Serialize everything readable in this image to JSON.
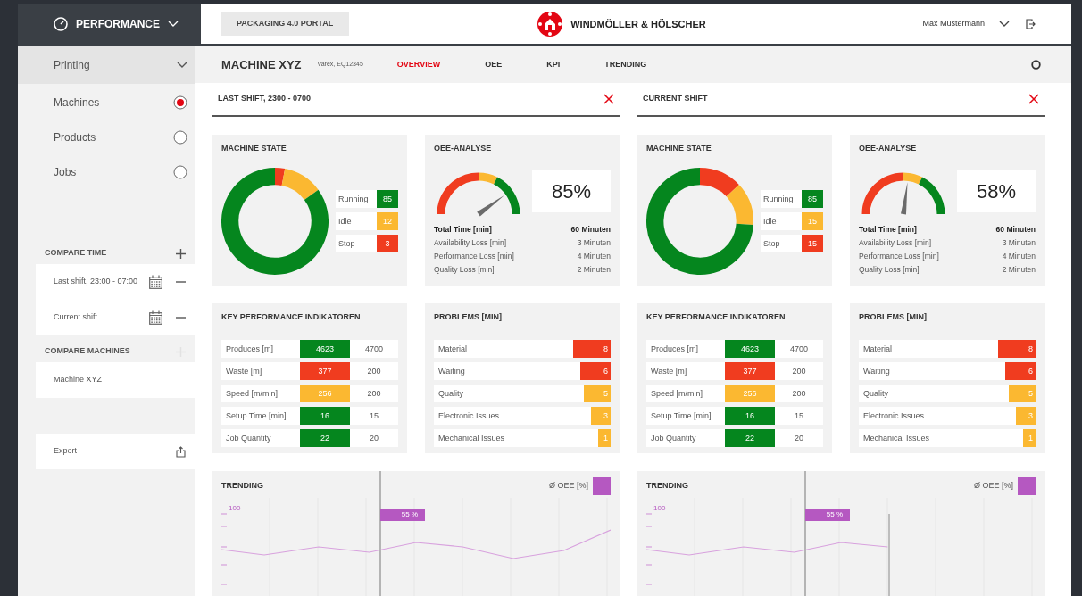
{
  "header": {
    "module": "PERFORMANCE",
    "portal": "PACKAGING 4.0 PORTAL",
    "brand": "WINDMÖLLER & HÖLSCHER",
    "user": "Max Mustermann"
  },
  "sidebar": {
    "category": "Printing",
    "items": [
      {
        "label": "Machines",
        "selected": true
      },
      {
        "label": "Products",
        "selected": false
      },
      {
        "label": "Jobs",
        "selected": false
      }
    ],
    "compare_time": {
      "title": "COMPARE TIME",
      "entries": [
        "Last shift, 23:00 - 07:00",
        "Current shift"
      ]
    },
    "compare_machines": {
      "title": "COMPARE MACHINES",
      "add_disabled": true,
      "entries": [
        "Machine XYZ"
      ]
    },
    "export": "Export"
  },
  "machine": {
    "name": "MACHINE XYZ",
    "subtitle": "Varex, EQ12345",
    "tabs": [
      {
        "label": "OVERVIEW",
        "selected": true
      },
      {
        "label": "OEE",
        "selected": false
      },
      {
        "label": "KPI",
        "selected": false
      },
      {
        "label": "TRENDING",
        "selected": false
      }
    ]
  },
  "shifts": [
    {
      "title": "LAST SHIFT, 2300 - 0700",
      "machine_state": {
        "title": "MACHINE STATE",
        "segments": [
          {
            "label": "Running",
            "value": "85",
            "color": "#05861e"
          },
          {
            "label": "Idle",
            "value": "12",
            "color": "#fbb831"
          },
          {
            "label": "Stop",
            "value": "3",
            "color": "#f03c1f"
          }
        ]
      },
      "oee": {
        "title": "OEE-ANALYSE",
        "percent": "85%",
        "rows": [
          {
            "label": "Total Time [min]",
            "value": "60 Minuten",
            "kind": "total"
          },
          {
            "label": "Availability Loss [min]",
            "value": "3 Minuten",
            "kind": "loss"
          },
          {
            "label": "Performance Loss [min]",
            "value": "4 Minuten",
            "kind": "loss"
          },
          {
            "label": "Quality Loss [min]",
            "value": "2 Minuten",
            "kind": "loss"
          }
        ]
      },
      "kpi": {
        "title": "KEY PERFORMANCE INDIKATOREN",
        "rows": [
          {
            "label": "Produces [m]",
            "actual": "4623",
            "target": "4700",
            "color": "#05861e"
          },
          {
            "label": "Waste [m]",
            "actual": "377",
            "target": "200",
            "color": "#f03c1f"
          },
          {
            "label": "Speed [m/min]",
            "actual": "256",
            "target": "200",
            "color": "#fbb831"
          },
          {
            "label": "Setup Time [min]",
            "actual": "16",
            "target": "15",
            "color": "#05861e"
          },
          {
            "label": "Job Quantity",
            "actual": "22",
            "target": "20",
            "color": "#05861e"
          }
        ]
      },
      "problems": {
        "title": "PROBLEMS [MIN]",
        "rows": [
          {
            "label": "Material",
            "value": "8",
            "color": "#f03c1f"
          },
          {
            "label": "Waiting",
            "value": "6",
            "color": "#f03c1f"
          },
          {
            "label": "Quality",
            "value": "5",
            "color": "#fbb831"
          },
          {
            "label": "Electronic Issues",
            "value": "3",
            "color": "#fbb831"
          },
          {
            "label": "Mechanical Issues",
            "value": "1",
            "color": "#fbb831"
          }
        ]
      },
      "trending": {
        "title": "TRENDING",
        "legend": "Ø OEE [%]",
        "tooltip": "55 %",
        "axis_label": "100"
      }
    },
    {
      "title": "CURRENT SHIFT",
      "machine_state": {
        "title": "MACHINE STATE",
        "segments": [
          {
            "label": "Running",
            "value": "85",
            "color": "#05861e"
          },
          {
            "label": "Idle",
            "value": "15",
            "color": "#fbb831"
          },
          {
            "label": "Stop",
            "value": "15",
            "color": "#f03c1f"
          }
        ]
      },
      "oee": {
        "title": "OEE-ANALYSE",
        "percent": "58%",
        "rows": [
          {
            "label": "Total Time [min]",
            "value": "60 Minuten",
            "kind": "total"
          },
          {
            "label": "Availability Loss [min]",
            "value": "3 Minuten",
            "kind": "loss"
          },
          {
            "label": "Performance Loss [min]",
            "value": "4 Minuten",
            "kind": "loss"
          },
          {
            "label": "Quality Loss [min]",
            "value": "2 Minuten",
            "kind": "loss"
          }
        ]
      },
      "kpi": {
        "title": "KEY PERFORMANCE INDIKATOREN",
        "rows": [
          {
            "label": "Produces [m]",
            "actual": "4623",
            "target": "4700",
            "color": "#05861e"
          },
          {
            "label": "Waste [m]",
            "actual": "377",
            "target": "200",
            "color": "#f03c1f"
          },
          {
            "label": "Speed [m/min]",
            "actual": "256",
            "target": "200",
            "color": "#fbb831"
          },
          {
            "label": "Setup Time [min]",
            "actual": "16",
            "target": "15",
            "color": "#05861e"
          },
          {
            "label": "Job Quantity",
            "actual": "22",
            "target": "20",
            "color": "#05861e"
          }
        ]
      },
      "problems": {
        "title": "PROBLEMS [MIN]",
        "rows": [
          {
            "label": "Material",
            "value": "8",
            "color": "#f03c1f"
          },
          {
            "label": "Waiting",
            "value": "6",
            "color": "#f03c1f"
          },
          {
            "label": "Quality",
            "value": "5",
            "color": "#fbb831"
          },
          {
            "label": "Electronic Issues",
            "value": "3",
            "color": "#fbb831"
          },
          {
            "label": "Mechanical Issues",
            "value": "1",
            "color": "#fbb831"
          }
        ]
      },
      "trending": {
        "title": "TRENDING",
        "legend": "Ø OEE [%]",
        "tooltip": "55 %",
        "axis_label": "100"
      }
    }
  ]
}
